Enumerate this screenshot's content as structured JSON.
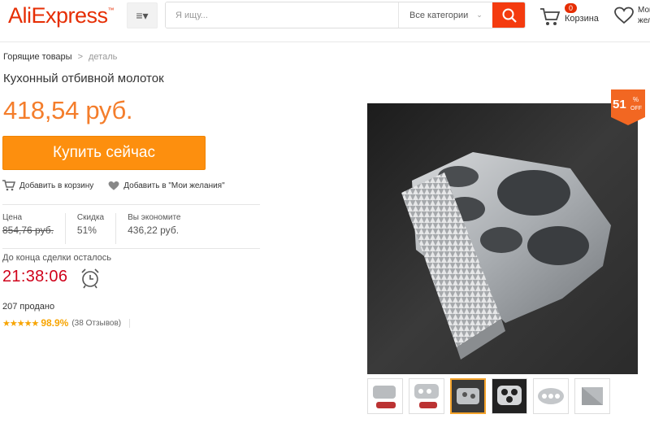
{
  "header": {
    "logo": "AliExpress",
    "logo_tm": "™",
    "menu_icon": "≡▾",
    "search_placeholder": "Я ищу...",
    "category": "Все категории",
    "cart_count": "0",
    "cart_label": "Корзина",
    "wishlist_label": "Мои желания"
  },
  "breadcrumb": {
    "root": "Горящие товары",
    "separator": ">",
    "current": "деталь"
  },
  "product": {
    "title": "Кухонный отбивной молоток",
    "price": "418,54 руб.",
    "buy_label": "Купить сейчас",
    "add_to_cart": "Добавить в корзину",
    "add_to_wishlist": "Добавить в \"Мои желания\"",
    "stats": [
      {
        "key": "Цена",
        "value": "854,76 руб."
      },
      {
        "key": "Скидка",
        "value": "51%"
      },
      {
        "key": "Вы экономите",
        "value": "436,22 руб."
      }
    ],
    "deal_label": "До конца сделки осталось",
    "timer": "21:38:06",
    "sold": "207 продано",
    "stars": "★★★★★",
    "rating_percent": "98.9%",
    "reviews": "(38 Отзывов)",
    "discount_badge": {
      "value": "51",
      "percent": "%",
      "off": "OFF"
    }
  },
  "colors": {
    "accent": "#e62e04",
    "price": "#f47d2b",
    "buy_button": "#fd8f0e",
    "timer": "#d0021b",
    "stars": "#f7a400"
  }
}
